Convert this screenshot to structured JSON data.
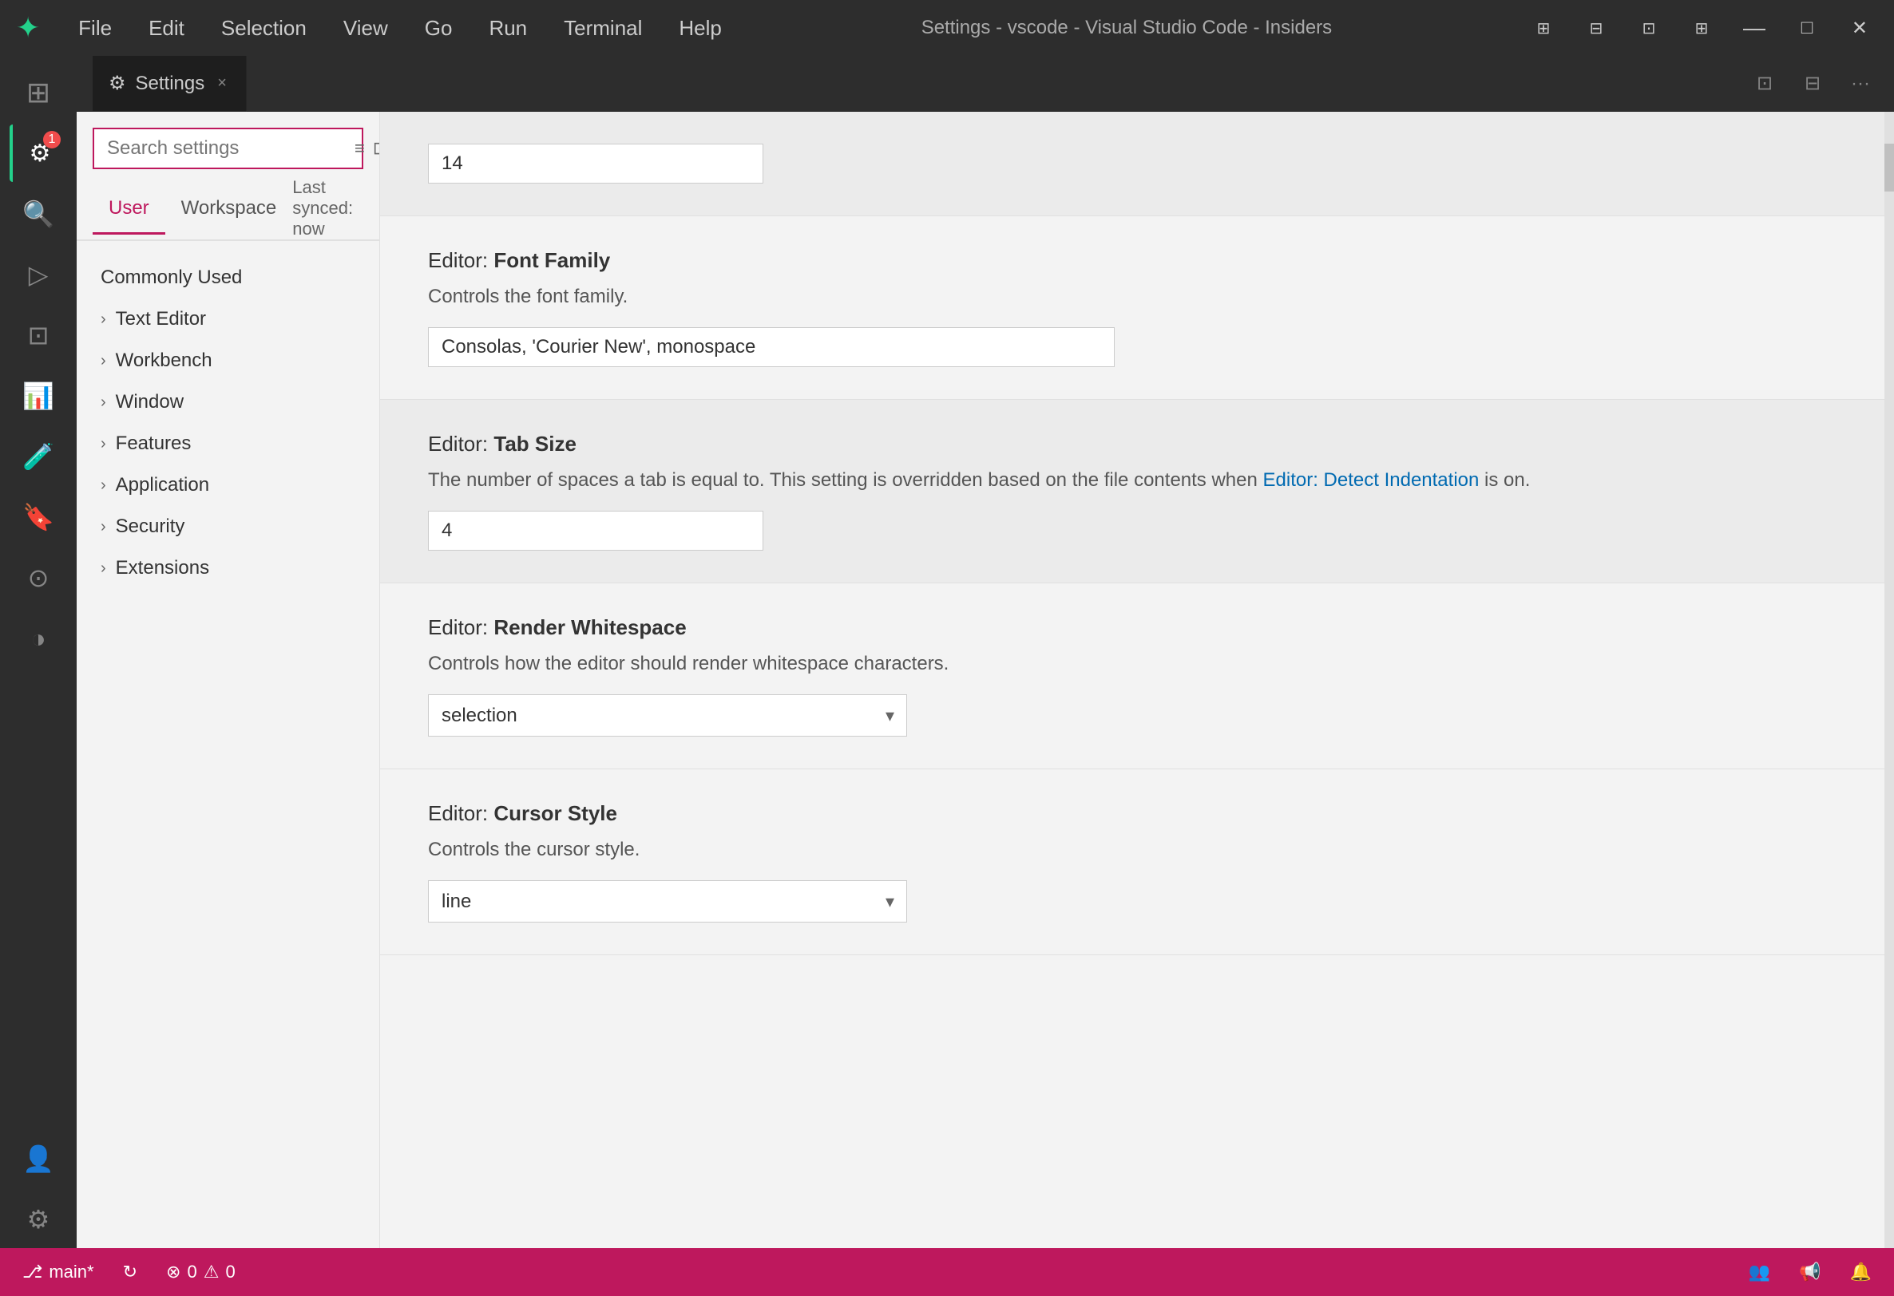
{
  "titlebar": {
    "logo": "✦",
    "menu": [
      "File",
      "Edit",
      "Selection",
      "View",
      "Go",
      "Run",
      "Terminal",
      "Help"
    ],
    "title": "Settings - vscode - Visual Studio Code - Insiders",
    "window_buttons": [
      "🗗",
      "—",
      "✕"
    ]
  },
  "activity_bar": {
    "items": [
      {
        "icon": "⊞",
        "name": "explorer-icon",
        "active": false
      },
      {
        "icon": "⚙",
        "name": "source-control-icon",
        "active": true,
        "badge": "1"
      },
      {
        "icon": "◎",
        "name": "search-icon",
        "active": false
      },
      {
        "icon": "▷",
        "name": "run-icon",
        "active": false
      },
      {
        "icon": "⊡",
        "name": "extensions-icon",
        "active": false
      },
      {
        "icon": "⊡",
        "name": "remote-icon",
        "active": false
      },
      {
        "icon": "🧪",
        "name": "testing-icon",
        "active": false
      },
      {
        "icon": "◉",
        "name": "bookmark-icon",
        "active": false
      },
      {
        "icon": "◎",
        "name": "github-icon",
        "active": false
      },
      {
        "icon": "◑",
        "name": "timeline-icon",
        "active": false
      },
      {
        "icon": "👤",
        "name": "account-icon",
        "active": false
      },
      {
        "icon": "⚙",
        "name": "settings-icon",
        "active": false
      }
    ]
  },
  "tab": {
    "icon": "⚙",
    "label": "Settings",
    "close_label": "×"
  },
  "tab_actions": {
    "open_settings_icon": "⊡",
    "split_icon": "⊡",
    "more_icon": "···"
  },
  "search": {
    "placeholder": "Search settings",
    "clear_icon": "≡",
    "filter_icon": "⊡"
  },
  "tabs": {
    "user_label": "User",
    "workspace_label": "Workspace",
    "sync_label": "Last synced: now"
  },
  "nav": {
    "items": [
      {
        "label": "Commonly Used",
        "type": "plain"
      },
      {
        "label": "Text Editor",
        "type": "expandable"
      },
      {
        "label": "Workbench",
        "type": "expandable"
      },
      {
        "label": "Window",
        "type": "expandable"
      },
      {
        "label": "Features",
        "type": "expandable"
      },
      {
        "label": "Application",
        "type": "expandable"
      },
      {
        "label": "Security",
        "type": "expandable"
      },
      {
        "label": "Extensions",
        "type": "expandable"
      }
    ]
  },
  "settings": [
    {
      "id": "font-size",
      "title_prefix": "Editor: ",
      "title_bold": "",
      "description": "",
      "input_value": "14",
      "input_type": "text",
      "highlighted": true
    },
    {
      "id": "font-family",
      "title_prefix": "Editor: ",
      "title_bold": "Font Family",
      "description": "Controls the font family.",
      "input_value": "Consolas, 'Courier New', monospace",
      "input_type": "text-wide",
      "highlighted": false
    },
    {
      "id": "tab-size",
      "title_prefix": "Editor: ",
      "title_bold": "Tab Size",
      "description_part1": "The number of spaces a tab is equal to. This setting is overridden based on the file contents when ",
      "link_text": "Editor: Detect Indentation",
      "description_part2": " is on.",
      "input_value": "4",
      "input_type": "text",
      "highlighted": true
    },
    {
      "id": "render-whitespace",
      "title_prefix": "Editor: ",
      "title_bold": "Render Whitespace",
      "description": "Controls how the editor should render whitespace characters.",
      "select_value": "selection",
      "input_type": "select",
      "highlighted": false
    },
    {
      "id": "cursor-style",
      "title_prefix": "Editor: ",
      "title_bold": "Cursor Style",
      "description": "Controls the cursor style.",
      "select_value": "line",
      "input_type": "select",
      "highlighted": false
    }
  ],
  "status": {
    "branch_icon": "⎇",
    "branch_label": "main*",
    "sync_icon": "↻",
    "error_icon": "⊗",
    "error_count": "0",
    "warning_icon": "⚠",
    "warning_count": "0",
    "right_icons": [
      "👥",
      "📢",
      "🔔"
    ]
  }
}
